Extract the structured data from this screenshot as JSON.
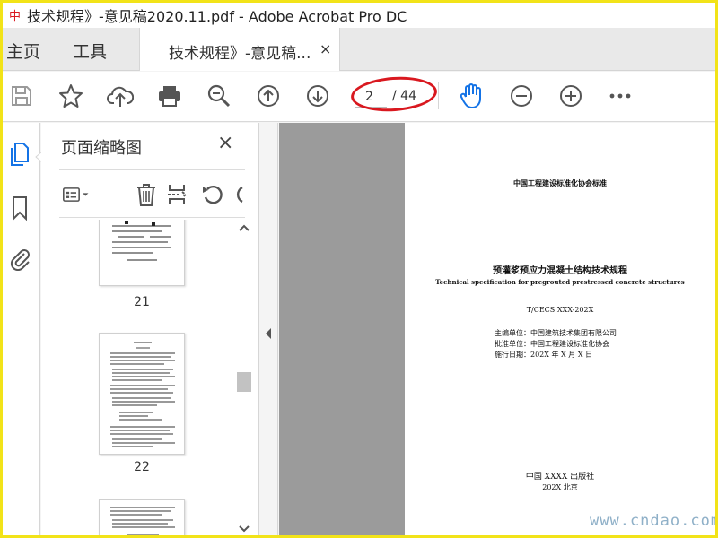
{
  "window": {
    "title": "技术规程》-意见稿2020.11.pdf - Adobe Acrobat Pro DC"
  },
  "tabs": {
    "home": "主页",
    "tools": "工具",
    "document": "技术规程》-意见稿...",
    "document_close": "×"
  },
  "toolbar": {
    "current_page": "2",
    "total_pages": "/ 44",
    "icons": [
      "save-icon",
      "bookmark-star-icon",
      "upload-cloud-icon",
      "print-icon",
      "zoom-search-icon",
      "page-up-icon",
      "page-down-icon",
      "hand-tool-icon",
      "zoom-out-icon",
      "zoom-in-icon",
      "more-icon"
    ],
    "hand_tool_color": "#1473e6",
    "annotation_color": "#d9181f"
  },
  "panel": {
    "title": "页面缩略图",
    "close": "×",
    "thumbnails": [
      {
        "page": "21"
      },
      {
        "page": "22"
      }
    ]
  },
  "document": {
    "org_standard": "中国工程建设标准化协会标准",
    "title_cn": "预灌浆预应力混凝土结构技术规程",
    "title_en": "Technical specification for pregrouted prestressed concrete structures",
    "code": "T/CECS    XXX-202X",
    "editor": "主编单位：中国建筑技术集团有限公司",
    "approver": "批准单位：中国工程建设标准化协会",
    "date": "施行日期：202X  年  X  月  X  日",
    "publisher": "中国 XXXX 出版社",
    "year_place": "202X    北京"
  },
  "watermark": "www.cndao.com",
  "colors": {
    "frame_border": "#f2e318",
    "viewport_bg": "#9b9b9b"
  }
}
